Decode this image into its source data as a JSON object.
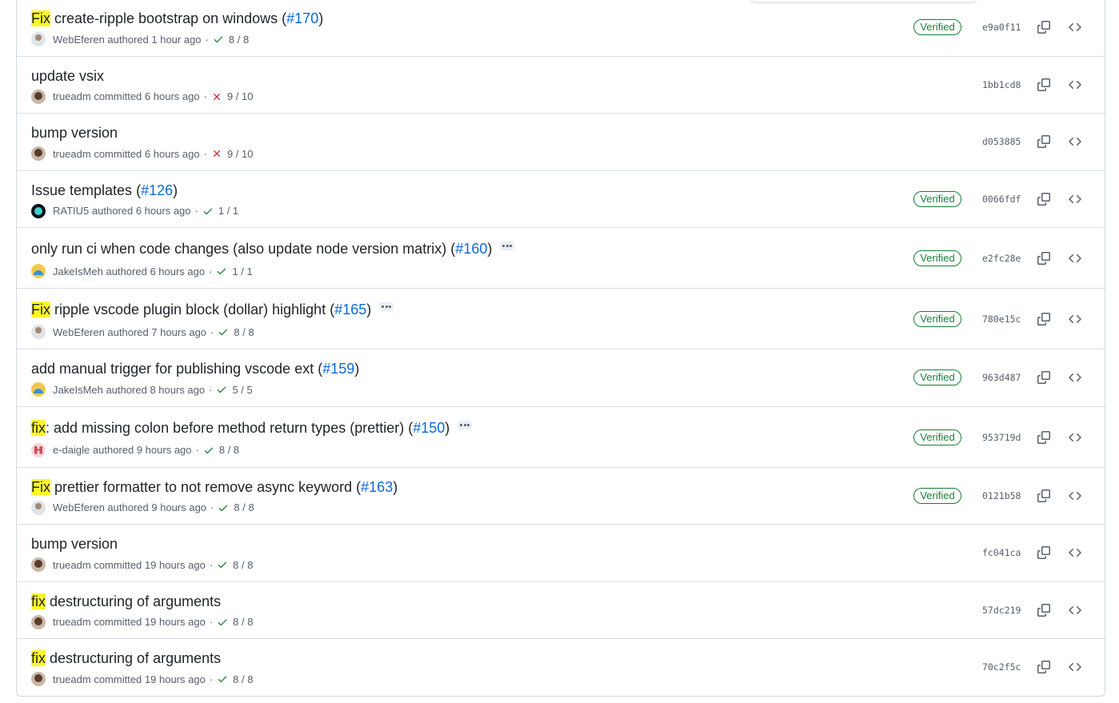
{
  "commits": [
    {
      "highlight": "Fix",
      "message": " create-ripple bootstrap on windows (",
      "pr": "#170",
      "suffix": ")",
      "author": "WebEferen",
      "action": "authored",
      "time": "1 hour ago",
      "status": "success",
      "checks": "8 / 8",
      "verified": "Verified",
      "sha": "e9a0f11",
      "avatar": "webeferen",
      "ellipsis": false
    },
    {
      "highlight": "",
      "message": "update vsix",
      "pr": "",
      "suffix": "",
      "author": "trueadm",
      "action": "committed",
      "time": "6 hours ago",
      "status": "failure",
      "checks": "9 / 10",
      "verified": "",
      "sha": "1bb1cd8",
      "avatar": "trueadm",
      "ellipsis": false
    },
    {
      "highlight": "",
      "message": "bump version",
      "pr": "",
      "suffix": "",
      "author": "trueadm",
      "action": "committed",
      "time": "6 hours ago",
      "status": "failure",
      "checks": "9 / 10",
      "verified": "",
      "sha": "d053885",
      "avatar": "trueadm",
      "ellipsis": false
    },
    {
      "highlight": "",
      "message": "Issue templates (",
      "pr": "#126",
      "suffix": ")",
      "author": "RATIU5",
      "action": "authored",
      "time": "6 hours ago",
      "status": "success",
      "checks": "1 / 1",
      "verified": "Verified",
      "sha": "0066fdf",
      "avatar": "ratiu5",
      "ellipsis": false
    },
    {
      "highlight": "",
      "message": "only run ci when code changes (also update node version matrix) (",
      "pr": "#160",
      "suffix": ")",
      "author": "JakeIsMeh",
      "action": "authored",
      "time": "6 hours ago",
      "status": "success",
      "checks": "1 / 1",
      "verified": "Verified",
      "sha": "e2fc28e",
      "avatar": "jakeismeh",
      "ellipsis": true
    },
    {
      "highlight": "Fix",
      "message": " ripple vscode plugin block (dollar) highlight (",
      "pr": "#165",
      "suffix": ")",
      "author": "WebEferen",
      "action": "authored",
      "time": "7 hours ago",
      "status": "success",
      "checks": "8 / 8",
      "verified": "Verified",
      "sha": "780e15c",
      "avatar": "webeferen",
      "ellipsis": true
    },
    {
      "highlight": "",
      "message": "add manual trigger for publishing vscode ext (",
      "pr": "#159",
      "suffix": ")",
      "author": "JakeIsMeh",
      "action": "authored",
      "time": "8 hours ago",
      "status": "success",
      "checks": "5 / 5",
      "verified": "Verified",
      "sha": "963d487",
      "avatar": "jakeismeh",
      "ellipsis": false
    },
    {
      "highlight": "fix",
      "message": ": add missing colon before method return types (prettier) (",
      "pr": "#150",
      "suffix": ")",
      "author": "e-daigle",
      "action": "authored",
      "time": "9 hours ago",
      "status": "success",
      "checks": "8 / 8",
      "verified": "Verified",
      "sha": "953719d",
      "avatar": "edaigle",
      "ellipsis": true
    },
    {
      "highlight": "Fix",
      "message": " prettier formatter to not remove async keyword (",
      "pr": "#163",
      "suffix": ")",
      "author": "WebEferen",
      "action": "authored",
      "time": "9 hours ago",
      "status": "success",
      "checks": "8 / 8",
      "verified": "Verified",
      "sha": "0121b58",
      "avatar": "webeferen",
      "ellipsis": false
    },
    {
      "highlight": "",
      "message": "bump version",
      "pr": "",
      "suffix": "",
      "author": "trueadm",
      "action": "committed",
      "time": "19 hours ago",
      "status": "success",
      "checks": "8 / 8",
      "verified": "",
      "sha": "fc041ca",
      "avatar": "trueadm",
      "ellipsis": false
    },
    {
      "highlight": "fix",
      "message": " destructuring of arguments",
      "pr": "",
      "suffix": "",
      "author": "trueadm",
      "action": "committed",
      "time": "19 hours ago",
      "status": "success",
      "checks": "8 / 8",
      "verified": "",
      "sha": "57dc219",
      "avatar": "trueadm",
      "ellipsis": false
    },
    {
      "highlight": "fix",
      "message": " destructuring of arguments",
      "pr": "",
      "suffix": "",
      "author": "trueadm",
      "action": "committed",
      "time": "19 hours ago",
      "status": "success",
      "checks": "8 / 8",
      "verified": "",
      "sha": "70c2f5c",
      "avatar": "trueadm",
      "ellipsis": false
    }
  ],
  "icons": {
    "success": "check-icon",
    "failure": "x-icon",
    "copy": "copy-icon",
    "browse": "code-icon"
  },
  "colors": {
    "success": "#1a7f37",
    "failure": "#cf222e",
    "link": "#0969da",
    "highlight": "#fff52b"
  },
  "separator": "·"
}
